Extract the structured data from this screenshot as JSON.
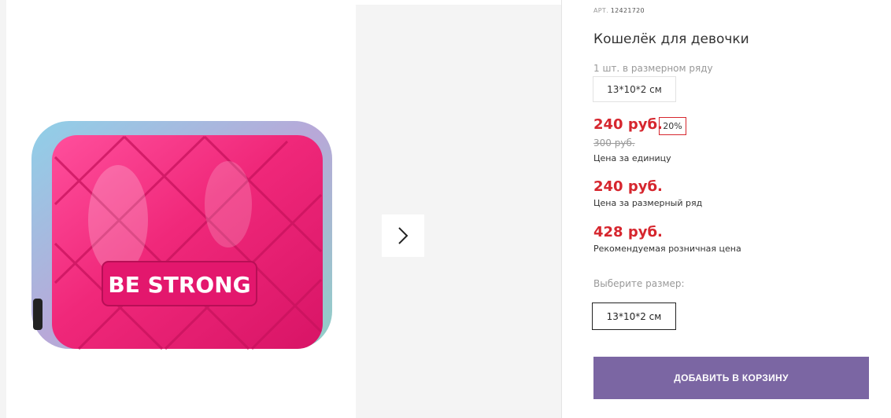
{
  "product": {
    "art_label": "АРТ.",
    "art_number": "12421720",
    "title": "Кошелёк для девочки",
    "series_note": "1 шт. в размерном ряду",
    "series_size": "13*10*2 см",
    "image_text": "BE STRONG"
  },
  "pricing": {
    "unit_price": "240 руб.",
    "discount": "20%",
    "old_price": "300 руб.",
    "unit_label": "Цена за единицу",
    "series_price": "240 руб.",
    "series_label": "Цена за размерный ряд",
    "retail_price": "428 руб.",
    "retail_label": "Рекомендуемая розничная цена"
  },
  "size_select": {
    "prompt": "Выберите размер:",
    "options": [
      "13*10*2 см"
    ],
    "selected": "13*10*2 см"
  },
  "actions": {
    "add_to_cart": "ДОБАВИТЬ В КОРЗИНУ"
  },
  "gallery": {
    "next_icon": "chevron-right-icon"
  },
  "colors": {
    "price_red": "#d6262e",
    "cart_button": "#7b66a3",
    "wallet_pink": "#f0287a"
  }
}
